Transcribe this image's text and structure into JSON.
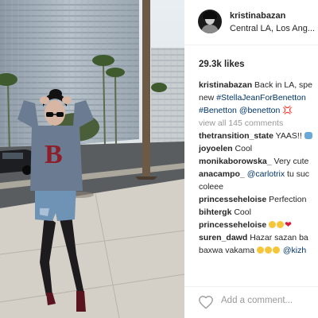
{
  "post": {
    "username": "kristinabazan",
    "location": "Central LA, Los Ang...",
    "likes": "29.3k likes",
    "caption": {
      "username": "kristinabazan",
      "line1_text": "Back in LA, spe",
      "line2_prefix": "new ",
      "line2_tag": "#StellaJeanForBenetton",
      "line3_tag": "#Benetton",
      "line3_mention": "@benetton",
      "line3_symbol": "💢"
    },
    "view_all": "view all 145 comments",
    "comments": [
      {
        "user": "thetransition_state",
        "text": "YAAS!!"
      },
      {
        "user": "joyoelen",
        "text": "Cool"
      },
      {
        "user": "monikaborowska_",
        "text": "Very cute"
      },
      {
        "user": "anacampo_",
        "mention": "@carlotrix",
        "text": "tu suc",
        "cont": "coleee"
      },
      {
        "user": "princesseheloise",
        "text": "Perfection"
      },
      {
        "user": "bihtergk",
        "text": "Cool"
      },
      {
        "user": "princesseheloise",
        "text": ""
      },
      {
        "user": "suren_dawd",
        "text": "Hazar sazan ba",
        "cont": "baxwa vakama",
        "cont_mention": "@kizh"
      }
    ],
    "add_comment_placeholder": "Add a comment...",
    "icons": {
      "avatar": "profile-avatar",
      "like": "heart-outline-icon"
    }
  }
}
